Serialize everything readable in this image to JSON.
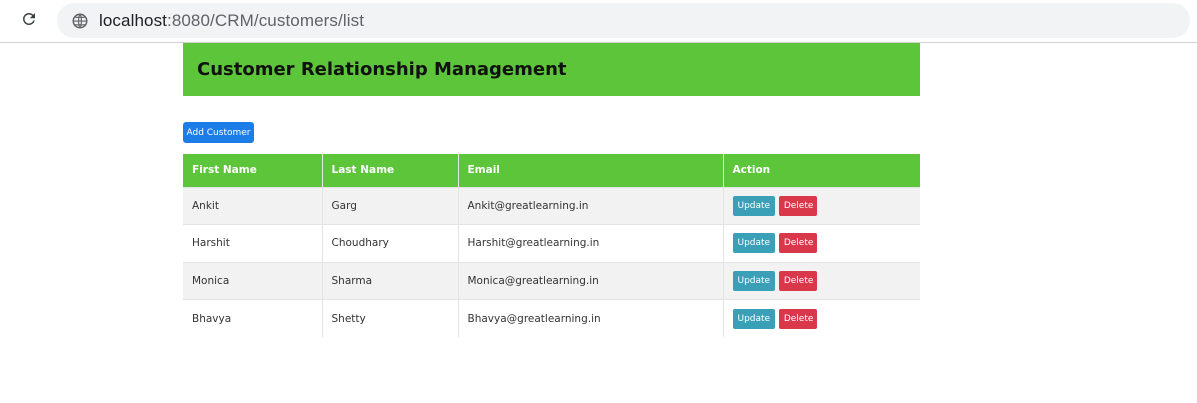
{
  "browser": {
    "url_host": "localhost",
    "url_rest": ":8080/CRM/customers/list"
  },
  "app": {
    "title": "Customer Relationship Management",
    "add_button_label": "Add Customer"
  },
  "table": {
    "columns": [
      "First Name",
      "Last Name",
      "Email",
      "Action"
    ],
    "rows": [
      {
        "first_name": "Ankit",
        "last_name": "Garg",
        "email": "Ankit@greatlearning.in"
      },
      {
        "first_name": "Harshit",
        "last_name": "Choudhary",
        "email": "Harshit@greatlearning.in"
      },
      {
        "first_name": "Monica",
        "last_name": "Sharma",
        "email": "Monica@greatlearning.in"
      },
      {
        "first_name": "Bhavya",
        "last_name": "Shetty",
        "email": "Bhavya@greatlearning.in"
      }
    ],
    "update_label": "Update",
    "delete_label": "Delete"
  },
  "colors": {
    "header_green": "#5cc53a",
    "add_blue": "#1d7de8",
    "update_teal": "#3aa0b8",
    "delete_red": "#d9374a"
  },
  "icons": {
    "reload": "reload-icon",
    "site": "site-info-icon"
  }
}
